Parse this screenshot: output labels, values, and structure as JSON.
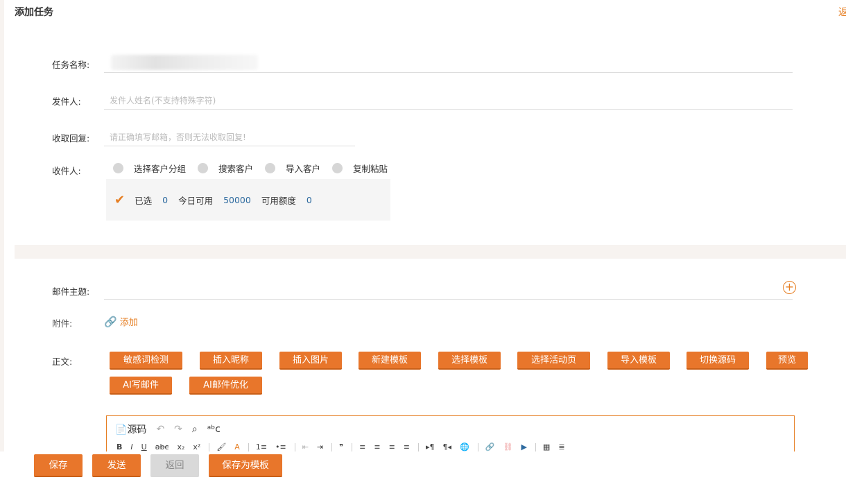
{
  "header": {
    "title": "添加任务",
    "back_label": "返回"
  },
  "form": {
    "task_name_label": "任务名称:",
    "sender_label": "发件人:",
    "sender_placeholder": "发件人姓名(不支持特殊字符)",
    "reply_label": "收取回复:",
    "reply_placeholder": "请正确填写邮箱，否则无法收取回复!",
    "recipient_label": "收件人:",
    "recipient_options": [
      "选择客户分组",
      "搜索客户",
      "导入客户",
      "复制粘贴"
    ],
    "stats": {
      "selected_label": "已选",
      "selected_value": "0",
      "today_label": "今日可用",
      "today_value": "50000",
      "quota_label": "可用额度",
      "quota_value": "0"
    },
    "subject_label": "邮件主题:",
    "attachment_label": "附件:",
    "attachment_add": "添加",
    "body_label": "正文:"
  },
  "body_buttons": [
    "敏感词检测",
    "插入昵称",
    "插入图片",
    "新建模板",
    "选择模板",
    "选择活动页",
    "导入模板",
    "切换源码",
    "预览",
    "AI写邮件",
    "AI邮件优化"
  ],
  "editor": {
    "source_label": "源码",
    "toolbar_row2": [
      "B",
      "I",
      "U",
      "abc",
      "x₂",
      "x²",
      "|",
      "🖌",
      "A",
      "|",
      "1≡",
      "•≡",
      "|",
      "⇤",
      "⇥",
      "|",
      "❞",
      "|",
      "≡",
      "≡",
      "≡",
      "≡",
      "|",
      "▸¶",
      "¶◂",
      "🌐",
      "|",
      "🔗",
      "⛓",
      "▶",
      "|",
      "▦",
      "≣"
    ]
  },
  "actions": {
    "save": "保存",
    "send": "发送",
    "back": "返回",
    "save_template": "保存为模板"
  },
  "colors": {
    "accent": "#e8762b",
    "number_blue": "#2d6a9f"
  }
}
